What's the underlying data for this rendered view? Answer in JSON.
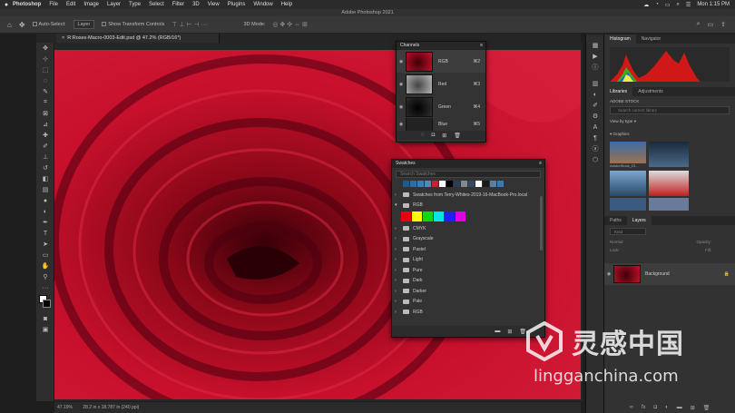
{
  "menubar": {
    "apple": "",
    "items": [
      "Photoshop",
      "File",
      "Edit",
      "Image",
      "Layer",
      "Type",
      "Select",
      "Filter",
      "3D",
      "View",
      "Plugins",
      "Window",
      "Help"
    ],
    "clock": "Mon 1:15 PM"
  },
  "window": {
    "title": "Adobe Photoshop 2021"
  },
  "options": {
    "auto_select": "Auto-Select:",
    "auto_select_target": "Layer",
    "show_transform": "Show Transform Controls",
    "mode_3d": "3D Mode:"
  },
  "document": {
    "tab_label": "R:Roses-Macro-0003-Edit.psd @ 47.2% (RGB/16*)",
    "zoom": "47.19%",
    "info": "28.2 in x 18.787 in (240 ppi)"
  },
  "channels": {
    "title": "Channels",
    "rows": [
      {
        "name": "RGB",
        "shortcut": "⌘2"
      },
      {
        "name": "Red",
        "shortcut": "⌘3"
      },
      {
        "name": "Green",
        "shortcut": "⌘4"
      },
      {
        "name": "Blue",
        "shortcut": "⌘5"
      }
    ]
  },
  "swatches": {
    "title": "Swatches",
    "search_placeholder": "Search Swatches",
    "recent_colors": [
      "#1e5a8a",
      "#2a6fa3",
      "#3a7db0",
      "#4a8cb8",
      "#c8202c",
      "#ffffff",
      "#000000",
      "#2c3e50",
      "#7f8c8d",
      "#34495e",
      "#ffffff",
      "#1a1a1a",
      "#5b7fa3",
      "#3c76b4"
    ],
    "groups": [
      {
        "name": "Swatches from Terry-Whites-2019-16-MacBook-Pro.local",
        "open": false
      },
      {
        "name": "RGB",
        "open": true,
        "colors": [
          "#e8000c",
          "#ffff00",
          "#14d414",
          "#00e5e5",
          "#2020ff",
          "#e000e0"
        ]
      },
      {
        "name": "CMYK",
        "open": false
      },
      {
        "name": "Grayscale",
        "open": false
      },
      {
        "name": "Pastel",
        "open": false
      },
      {
        "name": "Light",
        "open": false
      },
      {
        "name": "Pure",
        "open": false
      },
      {
        "name": "Dark",
        "open": false
      },
      {
        "name": "Darker",
        "open": false
      },
      {
        "name": "Pale",
        "open": false
      },
      {
        "name": "RGB",
        "open": false
      }
    ]
  },
  "histogram": {
    "tabs": [
      "Histogram",
      "Navigator"
    ]
  },
  "libraries": {
    "tabs": [
      "Libraries",
      "Adjustments"
    ],
    "library_name": "ADOBE STOCK",
    "search_placeholder": "Search current library",
    "view_by": "View by type",
    "section": "Graphics",
    "first_item": "AdobeStock_23..."
  },
  "layers": {
    "tabs": [
      "Paths",
      "Layers"
    ],
    "kind_placeholder": "Kind",
    "blend_mode": "Normal",
    "opacity_label": "Opacity:",
    "lock_label": "Lock:",
    "fill_label": "Fill:",
    "layer_name": "Background"
  },
  "watermark": {
    "brand": "灵感中国",
    "url": "lingganchina.com"
  },
  "colors": {
    "menubar": "#2b2b2b",
    "panel": "#323232",
    "canvas_red": "#c0102a"
  }
}
